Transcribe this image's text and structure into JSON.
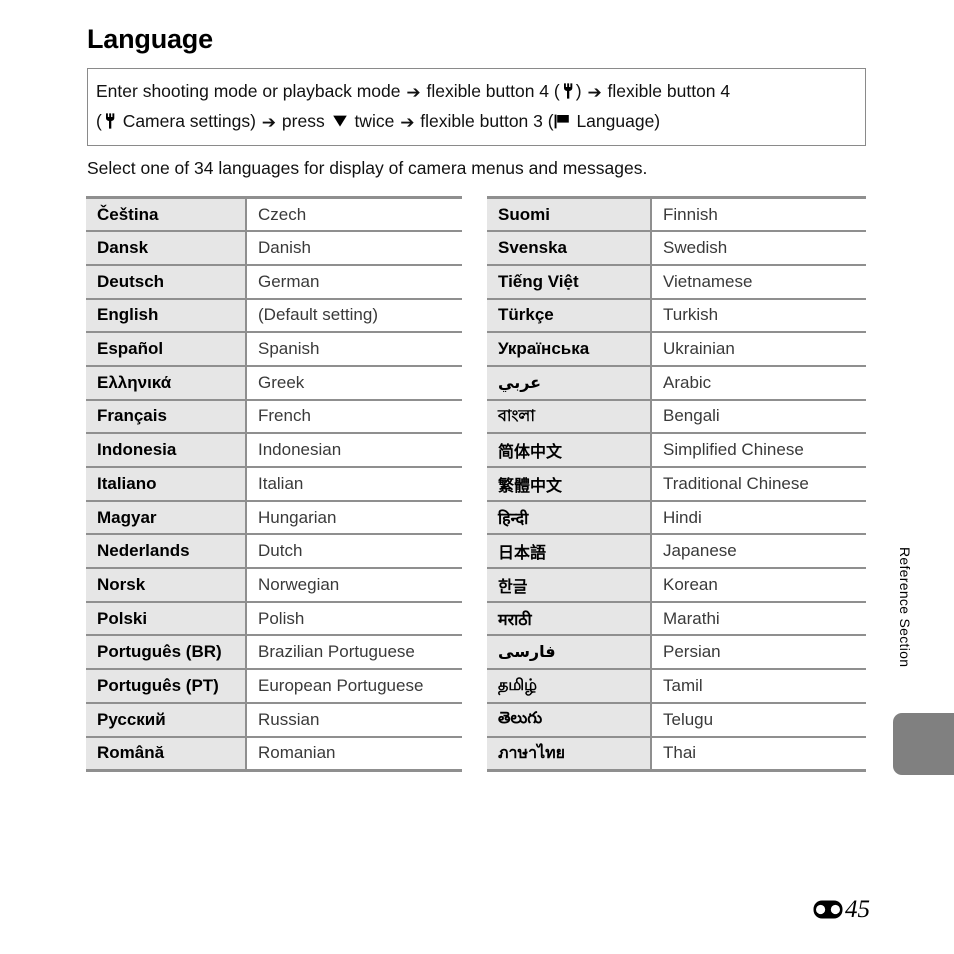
{
  "page": {
    "title": "Language",
    "intro": "Select one of 34 languages for display of camera menus and messages.",
    "section_label": "Reference Section",
    "page_number": "45",
    "refsection_icon": "reference-section-icon"
  },
  "instruction": {
    "line1_a": "Enter shooting mode or playback mode ",
    "line1_arrow1": "➔",
    "line1_b": " flexible button 4 (",
    "line1_wrench": "wrench-icon",
    "line1_c": ") ",
    "line1_arrow2": "➔",
    "line1_d": " flexible button 4",
    "line2_a": "(",
    "line2_wrench": "wrench-icon",
    "line2_b": " Camera settings) ",
    "line2_arrow1": "➔",
    "line2_c": " press ",
    "line2_down": "down-triangle-icon",
    "line2_d": " twice ",
    "line2_arrow2": "➔",
    "line2_e": " flexible button 3 (",
    "line2_flag": "flag-icon",
    "line2_f": " Language)"
  },
  "tables": {
    "left": {
      "rows": [
        {
          "native": "Čeština",
          "english": "Czech",
          "script": false
        },
        {
          "native": "Dansk",
          "english": "Danish",
          "script": false
        },
        {
          "native": "Deutsch",
          "english": "German",
          "script": false
        },
        {
          "native": "English",
          "english": "(Default setting)",
          "script": false
        },
        {
          "native": "Español",
          "english": "Spanish",
          "script": false
        },
        {
          "native": "Ελληνικά",
          "english": "Greek",
          "script": false
        },
        {
          "native": "Français",
          "english": "French",
          "script": false
        },
        {
          "native": "Indonesia",
          "english": "Indonesian",
          "script": false
        },
        {
          "native": "Italiano",
          "english": "Italian",
          "script": false
        },
        {
          "native": "Magyar",
          "english": "Hungarian",
          "script": false
        },
        {
          "native": "Nederlands",
          "english": "Dutch",
          "script": false
        },
        {
          "native": "Norsk",
          "english": "Norwegian",
          "script": false
        },
        {
          "native": "Polski",
          "english": "Polish",
          "script": false
        },
        {
          "native": "Português (BR)",
          "english": "Brazilian Portuguese",
          "script": false
        },
        {
          "native": "Português (PT)",
          "english": "European Portuguese",
          "script": false
        },
        {
          "native": "Русский",
          "english": "Russian",
          "script": false
        },
        {
          "native": "Română",
          "english": "Romanian",
          "script": false
        }
      ]
    },
    "right": {
      "rows": [
        {
          "native": "Suomi",
          "english": "Finnish",
          "script": false
        },
        {
          "native": "Svenska",
          "english": "Swedish",
          "script": false
        },
        {
          "native": "Tiếng Việt",
          "english": "Vietnamese",
          "script": false
        },
        {
          "native": "Türkçe",
          "english": "Turkish",
          "script": false
        },
        {
          "native": "Українська",
          "english": "Ukrainian",
          "script": false
        },
        {
          "native": "عربي",
          "english": "Arabic",
          "script": true
        },
        {
          "native": "বাংলা",
          "english": "Bengali",
          "script": true
        },
        {
          "native": "简体中文",
          "english": "Simplified Chinese",
          "script": true
        },
        {
          "native": "繁體中文",
          "english": "Traditional Chinese",
          "script": true
        },
        {
          "native": "हिन्दी",
          "english": "Hindi",
          "script": true
        },
        {
          "native": "日本語",
          "english": "Japanese",
          "script": true
        },
        {
          "native": "한글",
          "english": "Korean",
          "script": true
        },
        {
          "native": "मराठी",
          "english": "Marathi",
          "script": true
        },
        {
          "native": "فارسی",
          "english": "Persian",
          "script": true
        },
        {
          "native": "தமிழ்",
          "english": "Tamil",
          "script": true
        },
        {
          "native": "తెలుగు",
          "english": "Telugu",
          "script": true
        },
        {
          "native": "ภาษาไทย",
          "english": "Thai",
          "script": true
        }
      ]
    }
  },
  "colors": {
    "native_cell_bg": "#e6e6e6",
    "rule": "#8f8f8f",
    "box_border": "#8a8a8a",
    "thumb_tab": "#808080",
    "english_text": "#3a3a3a"
  }
}
